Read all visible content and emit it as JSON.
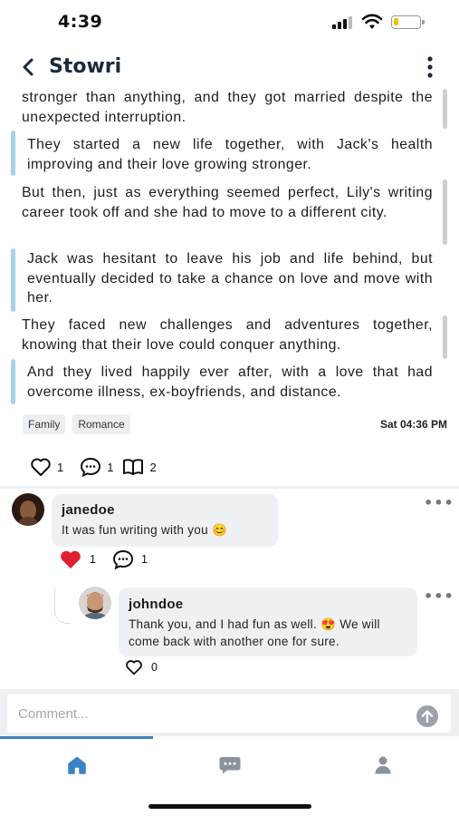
{
  "status_bar": {
    "time": "4:39",
    "battery_level": 0.2,
    "battery_color": "#f2c200"
  },
  "header": {
    "title": "Stowri",
    "back_icon": "chevron-left-icon",
    "menu_icon": "more-vertical-icon"
  },
  "story": {
    "paragraphs": [
      {
        "text": "stronger than anything, and they got married despite the unexpected interruption.",
        "side": "right"
      },
      {
        "text": "They started a new life together, with Jack's health improving and their love growing stronger.",
        "side": "left"
      },
      {
        "text": "But then, just as everything seemed perfect, Lily's writing career took off and she had to move to a different city.",
        "side": "right"
      },
      {
        "text": "Jack was hesitant to leave his job and life behind, but eventually decided to take a chance on love and move with her.",
        "side": "left"
      },
      {
        "text": "They faced new challenges and adventures together, knowing that their love could conquer anything.",
        "side": "right"
      },
      {
        "text": "And they lived happily ever after, with a love that had overcome illness, ex-boyfriends, and distance.",
        "side": "left"
      }
    ],
    "tags": [
      "Family",
      "Romance"
    ],
    "date": "Sat 04:36 PM",
    "stats": {
      "likes": "1",
      "comments": "1",
      "reads": "2"
    },
    "left_bar_color": "#a9d2ea",
    "right_bar_color": "#cfcfcf"
  },
  "comments": [
    {
      "user": "janedoe",
      "text": "It was fun writing with you 😊",
      "likes": "1",
      "replies": "1",
      "liked": true,
      "like_color": "#e0202e",
      "reply": {
        "user": "johndoe",
        "text": "Thank you, and I had fun as well. 😍 We will come back with another one for sure.",
        "likes": "0"
      }
    }
  ],
  "comment_input": {
    "placeholder": "Comment...",
    "send_icon": "arrow-up-circle-icon"
  },
  "nav": {
    "items": [
      {
        "name": "home",
        "icon": "home-icon",
        "active": true
      },
      {
        "name": "messages",
        "icon": "chat-bubble-icon",
        "active": false
      },
      {
        "name": "profile",
        "icon": "user-icon",
        "active": false
      }
    ],
    "accent": "#3b82c4"
  }
}
